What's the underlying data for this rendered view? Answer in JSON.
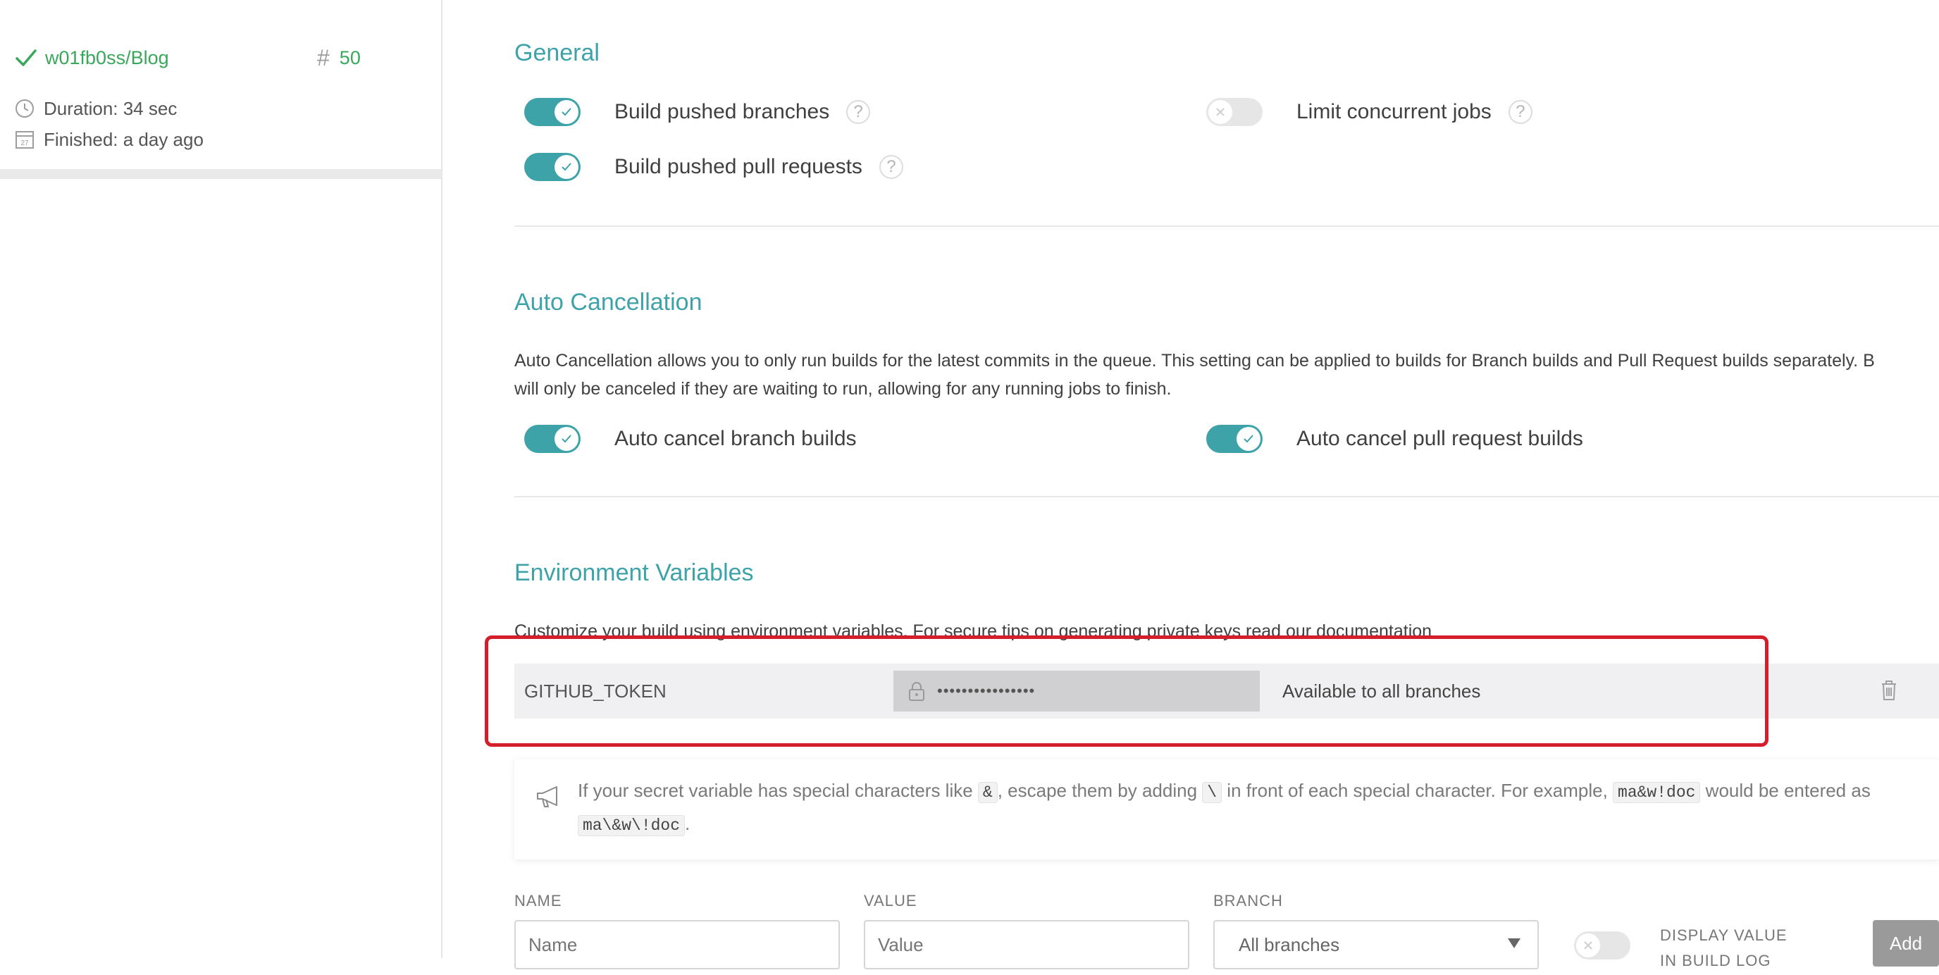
{
  "sidebar": {
    "repo": "w01fb0ss/Blog",
    "build_hash": "#",
    "build_number": "50",
    "duration": "Duration: 34 sec",
    "finished": "Finished: a day ago",
    "calendar_day": "27"
  },
  "general": {
    "title": "General",
    "build_pushed_branches": "Build pushed branches",
    "build_pushed_pull_requests": "Build pushed pull requests",
    "limit_concurrent_jobs": "Limit concurrent jobs",
    "help": "?"
  },
  "auto_cancellation": {
    "title": "Auto Cancellation",
    "description_line1": "Auto Cancellation allows you to only run builds for the latest commits in the queue. This setting can be applied to builds for Branch builds and Pull Request builds separately. B",
    "description_line2": "will only be canceled if they are waiting to run, allowing for any running jobs to finish.",
    "branch_builds": "Auto cancel branch builds",
    "pull_request_builds": "Auto cancel pull request builds"
  },
  "env": {
    "title": "Environment Variables",
    "description": "Customize your build using environment variables. For secure tips on generating private keys read our documentation",
    "variable": {
      "name": "GITHUB_TOKEN",
      "value": "••••••••••••••••",
      "branch": "Available to all branches"
    },
    "notice": {
      "part1": "If your secret variable has special characters like ",
      "code1": "&",
      "part2": ", escape them by adding ",
      "code2": "\\",
      "part3": " in front of each special character. For example, ",
      "code3": "ma&w!doc",
      "part4": " would be entered as",
      "code4": "ma\\&w\\!doc",
      "part5": "."
    },
    "form": {
      "name_label": "NAME",
      "value_label": "VALUE",
      "branch_label": "BRANCH",
      "name_placeholder": "Name",
      "value_placeholder": "Value",
      "branch_selected": "All branches",
      "display_value_label": "DISPLAY VALUE IN BUILD LOG",
      "add": "Add"
    }
  },
  "colors": {
    "accent": "#3ea3a9",
    "success": "#39a85b",
    "highlight": "#d41e2b"
  }
}
